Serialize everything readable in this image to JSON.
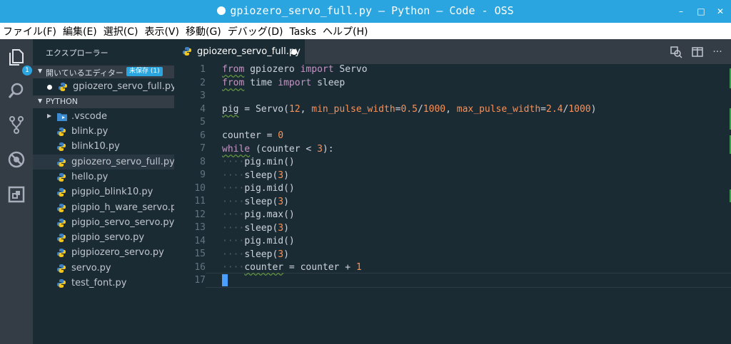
{
  "window": {
    "title": "gpiozero_servo_full.py — Python — Code - OSS",
    "minimize": "–",
    "maximize": "□",
    "close": "✕"
  },
  "menu": [
    "ファイル(F)",
    "編集(E)",
    "選択(C)",
    "表示(V)",
    "移動(G)",
    "デバッグ(D)",
    "Tasks",
    "ヘルプ(H)"
  ],
  "activity": {
    "explorer_badge": "1"
  },
  "sidebar": {
    "title": "エクスプローラー",
    "open_editors": {
      "label": "開いているエディター",
      "unsaved_badge": "未保存 (1)",
      "files": [
        "gpiozero_servo_full.py"
      ]
    },
    "project": {
      "label": "PYTHON",
      "folder": ".vscode",
      "files": [
        "blink.py",
        "blink10.py",
        "gpiozero_servo_full.py",
        "hello.py",
        "pigpio_blink10.py",
        "pigpio_h_ware_servo.py",
        "pigpio_servo_servo.py",
        "pigpio_servo.py",
        "pigpiozero_servo.py",
        "servo.py",
        "test_font.py"
      ],
      "active_file": "gpiozero_servo_full.py"
    }
  },
  "editor": {
    "tab": "gpiozero_servo_full.py",
    "line_numbers": [
      "1",
      "2",
      "3",
      "4",
      "5",
      "6",
      "7",
      "8",
      "9",
      "10",
      "11",
      "12",
      "13",
      "14",
      "15",
      "16",
      "17"
    ],
    "code": {
      "l1": [
        "from",
        " gpiozero ",
        "import",
        " Servo"
      ],
      "l2": [
        "from",
        " time ",
        "import",
        " sleep"
      ],
      "l4": [
        "pig",
        " = Servo(",
        "12",
        ", ",
        "min_pulse_width",
        "=",
        "0.5",
        "/",
        "1000",
        ", ",
        "max_pulse_width",
        "=",
        "2.4",
        "/",
        "1000",
        ")"
      ],
      "l6": [
        "counter = ",
        "0"
      ],
      "l7": [
        "while",
        " (counter < ",
        "3",
        "):"
      ],
      "indent": "····",
      "l8": "pig.min()",
      "l9": [
        "sleep(",
        "3",
        ")"
      ],
      "l10": "pig.mid()",
      "l11": [
        "sleep(",
        "3",
        ")"
      ],
      "l12": "pig.max()",
      "l13": [
        "sleep(",
        "3",
        ")"
      ],
      "l14": "pig.mid()",
      "l15": [
        "sleep(",
        "3",
        ")"
      ],
      "l16": [
        "counter",
        " = counter + ",
        "1"
      ]
    }
  },
  "colors": {
    "accent": "#2aa5df",
    "bg": "#1b2b34",
    "keyword": "#c594c5",
    "number": "#f99157"
  }
}
